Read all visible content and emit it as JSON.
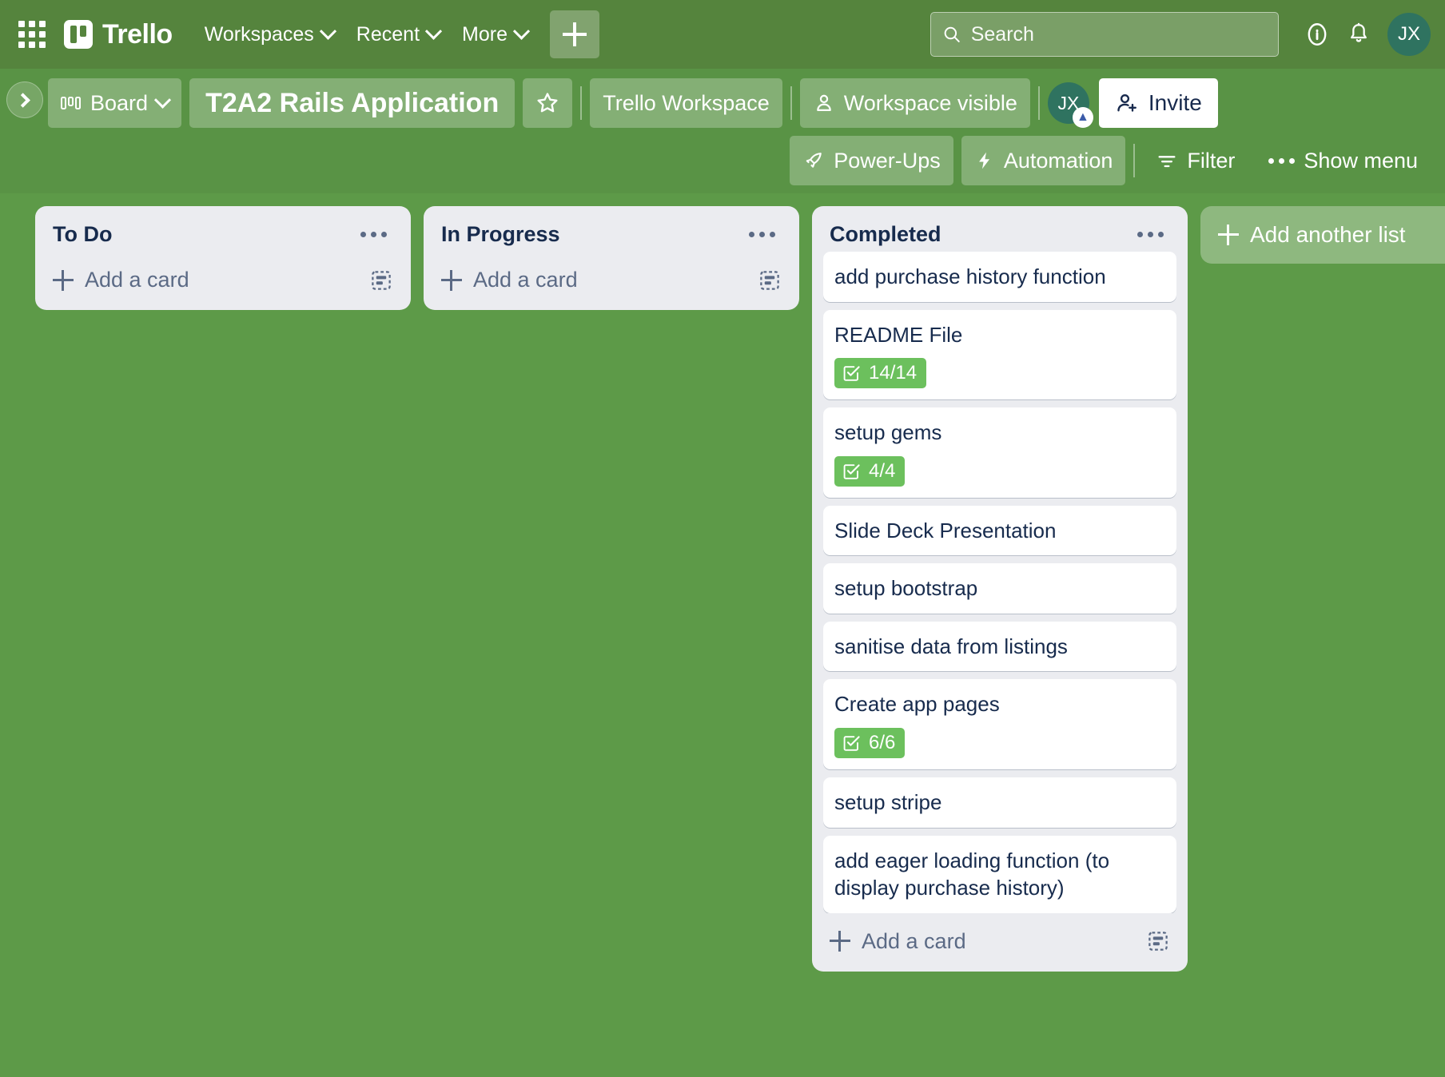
{
  "topnav": {
    "apps_icon": "apps-grid-icon",
    "brand": "Trello",
    "menus": [
      {
        "label": "Workspaces"
      },
      {
        "label": "Recent"
      },
      {
        "label": "More"
      }
    ],
    "create_button_label": "+",
    "search": {
      "placeholder": "Search",
      "value": ""
    },
    "info_icon": "info-circle-icon",
    "notifications_icon": "bell-icon",
    "avatar_initials": "JX"
  },
  "board_header": {
    "sidebar_toggle_icon": "chevron-right-icon",
    "view_switcher": {
      "label": "Board",
      "icon": "board-view-icon"
    },
    "title": "T2A2 Rails Application",
    "star_icon": "star-icon",
    "workspace_label": "Trello Workspace",
    "visibility_label": "Workspace visible",
    "visibility_icon": "person-icon",
    "member_avatar": "JX",
    "member_badge": "premium-chevrons-icon",
    "invite_label": "Invite",
    "invite_icon": "person-add-icon",
    "power_ups_label": "Power-Ups",
    "power_ups_icon": "rocket-icon",
    "automation_label": "Automation",
    "automation_icon": "lightning-bolt-icon",
    "filter_label": "Filter",
    "filter_icon": "filter-icon",
    "show_menu_label": "Show menu",
    "show_menu_icon": "ellipsis-icon"
  },
  "colors": {
    "board_background": "#5d9a48",
    "topnav_background": "#55843d",
    "list_background": "#ebecf0",
    "card_background": "#ffffff",
    "text_dark": "#172b4d",
    "checklist_badge": "#6cc05d",
    "avatar": "#2f7360"
  },
  "lists": [
    {
      "title": "To Do",
      "menu_icon": "ellipsis-icon",
      "cards": [],
      "add_card_label": "Add a card",
      "add_card_icon": "plus-icon",
      "template_icon": "card-template-icon"
    },
    {
      "title": "In Progress",
      "menu_icon": "ellipsis-icon",
      "cards": [],
      "add_card_label": "Add a card",
      "add_card_icon": "plus-icon",
      "template_icon": "card-template-icon"
    },
    {
      "title": "Completed",
      "menu_icon": "ellipsis-icon",
      "cards": [
        {
          "title": "add purchase history function",
          "checklist": null
        },
        {
          "title": "README File",
          "checklist": "14/14"
        },
        {
          "title": "setup gems",
          "checklist": "4/4"
        },
        {
          "title": "Slide Deck Presentation",
          "checklist": null
        },
        {
          "title": "setup bootstrap",
          "checklist": null
        },
        {
          "title": "sanitise data from listings",
          "checklist": null
        },
        {
          "title": "Create app pages",
          "checklist": "6/6"
        },
        {
          "title": "setup stripe",
          "checklist": null
        },
        {
          "title": "add eager loading function (to display purchase history)",
          "checklist": null
        }
      ],
      "add_card_label": "Add a card",
      "add_card_icon": "plus-icon",
      "template_icon": "card-template-icon"
    }
  ],
  "add_list": {
    "label": "Add another list",
    "icon": "plus-icon"
  }
}
